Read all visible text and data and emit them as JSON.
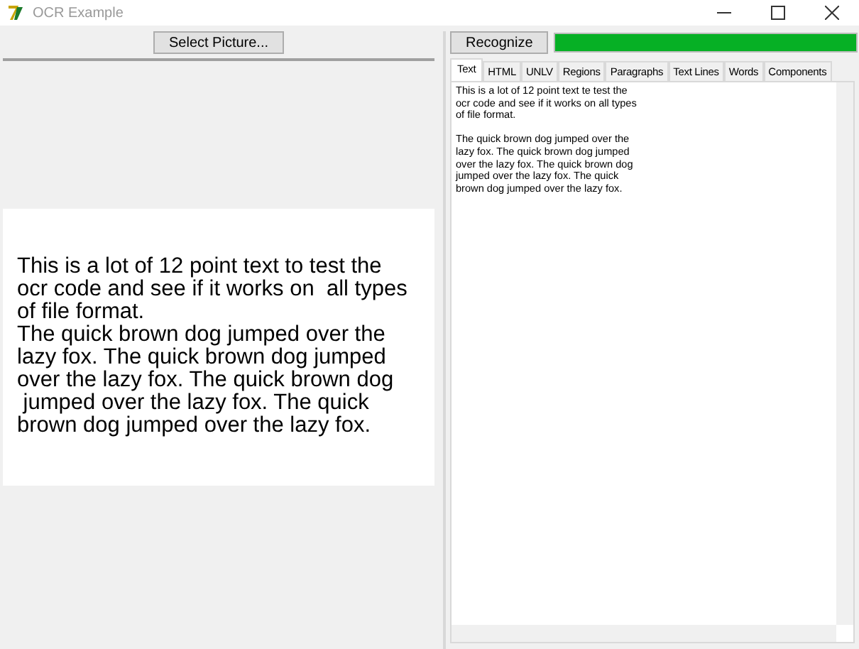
{
  "window": {
    "title": "OCR Example"
  },
  "select_button": "Select Picture...",
  "document_lines": [
    "This is a lot of 12 point text to test the",
    "ocr code and see if it works on  all types",
    "of file format.",
    "The quick brown dog jumped over the",
    "lazy fox. The quick brown dog jumped",
    "over the lazy fox. The quick brown dog",
    " jumped over the lazy fox. The quick",
    "brown dog jumped over the lazy fox."
  ],
  "recognize_button": "Recognize",
  "progress": {
    "level": 1
  },
  "tabs": [
    {
      "label": "Text",
      "selected": true
    },
    {
      "label": "HTML",
      "selected": false
    },
    {
      "label": "UNLV",
      "selected": false
    },
    {
      "label": "Regions",
      "selected": false
    },
    {
      "label": "Paragraphs",
      "selected": false
    },
    {
      "label": "Text Lines",
      "selected": false
    },
    {
      "label": "Words",
      "selected": false
    },
    {
      "label": "Components",
      "selected": false
    }
  ],
  "output_text": "This is a lot of 12 point text te test the\nocr code and see if it works on all types\nof file format.\n\nThe quick brown dog jumped over the\nlazy fox. The quick brown dog jumped\nover the lazy fox. The quick brown dog\njumped over the lazy fox. The quick\nbrown dog jumped over the lazy fox."
}
